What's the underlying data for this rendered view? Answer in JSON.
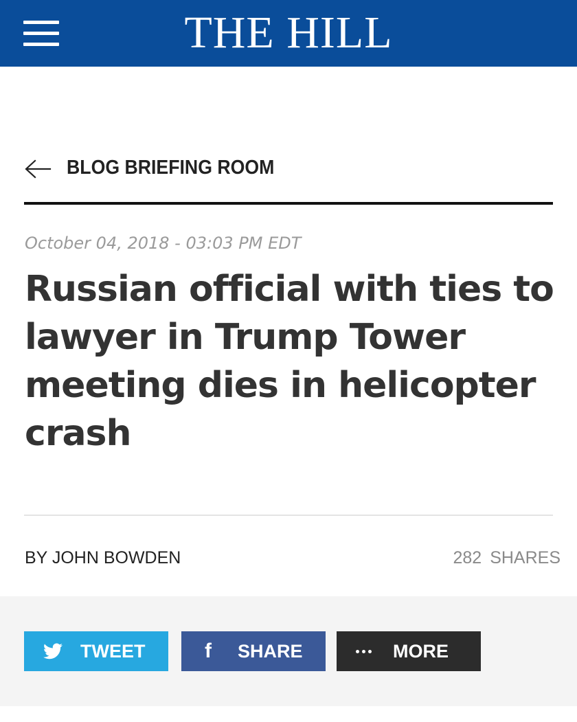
{
  "header": {
    "logo": "THE HILL",
    "bg_color": "#0a4d9a",
    "menu_icon": "hamburger-menu-icon"
  },
  "section": {
    "back_icon": "arrow-left-icon",
    "label": "BLOG BRIEFING ROOM"
  },
  "article": {
    "date": "October 04, 2018 - 03:03 PM EDT",
    "headline": "Russian official with ties to lawyer in Trump Tower meeting dies in helicopter crash",
    "byline": "BY JOHN BOWDEN",
    "share_count": "282",
    "share_label": "SHARES"
  },
  "share_buttons": {
    "tweet": {
      "label": "TWEET",
      "icon": "twitter-bird-icon",
      "color": "#27a8e0"
    },
    "share": {
      "label": "SHARE",
      "icon": "facebook-f-icon",
      "color": "#3b5998"
    },
    "more": {
      "label": "MORE",
      "icon": "ellipsis-icon",
      "color": "#2c2c2c"
    }
  }
}
